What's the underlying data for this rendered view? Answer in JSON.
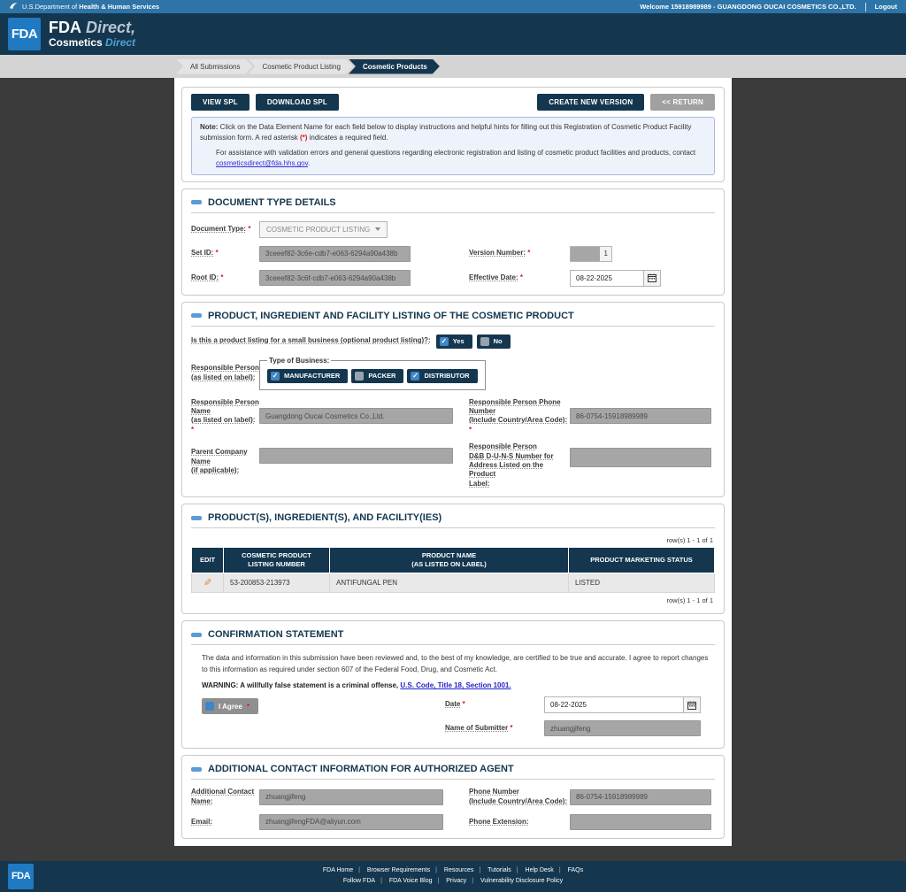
{
  "colors": {
    "navy": "#14374f",
    "topbar": "#2d74a8",
    "fdablue": "#1f7ac2",
    "linkblue": "#3333cc",
    "req": "#e01616",
    "fieldgray": "#a6a6a6",
    "editorange": "#d98e2b",
    "check": "#3f86c6"
  },
  "ui": {
    "req": "*"
  },
  "topbar": {
    "dept_prefix": "U.S.Department of ",
    "dept_bold": "Health & Human Services",
    "welcome": "Welcome 15918989989 - GUANGDONG OUCAI COSMETICS CO.,LTD.",
    "logout": "Logout"
  },
  "header": {
    "logo": "FDA",
    "title": "FDA",
    "title_italic": " Direct,",
    "subtitle": "Cosmetics",
    "subtitle_italic": " Direct"
  },
  "breadcrumb": {
    "items": [
      "All Submissions",
      "Cosmetic Product Listing",
      "Cosmetic Products"
    ]
  },
  "toolbar": {
    "view_spl": "VIEW SPL",
    "download_spl": "DOWNLOAD SPL",
    "create_new_version": "CREATE NEW VERSION",
    "return_label": "<< RETURN"
  },
  "note": {
    "label": "Note:",
    "body": " Click on the Data Element Name for each field below to display instructions and helpful hints for filling out this Registration of Cosmetic Product Facility submission form. A red asterisk ",
    "asterisk": "(*)",
    "tail": " indicates a required field.",
    "help_prefix": "For assistance with validation errors and general questions regarding electronic registration and listing of cosmetic product facilities and products, contact ",
    "help_link": "cosmeticsdirect@fda.hhs.gov",
    "help_suffix": "."
  },
  "document_type": {
    "title": "DOCUMENT TYPE DETAILS",
    "document_type_label": "Document Type:",
    "document_type_value": "COSMETIC PRODUCT LISTING",
    "set_id_label": "Set ID:",
    "set_id_value": "3ceeef82-3c6e-cdb7-e063-6294a90a438b",
    "version_label": "Version Number:",
    "version_value": "1",
    "root_id_label": "Root ID:",
    "root_id_value": "3ceeef82-3c6f-cdb7-e063-6294a90a438b",
    "effective_date_label": "Effective Date:",
    "effective_date_value": "08-22-2025"
  },
  "product_listing": {
    "title": "PRODUCT, INGREDIENT AND FACILITY LISTING OF THE COSMETIC PRODUCT",
    "small_business_question": "Is this a product listing for a small business (optional product listing)?:",
    "yes_label": "Yes",
    "no_label": "No",
    "yes_checked": true,
    "no_checked": false,
    "responsible_person_label": "Responsible Person\n(as listed on label):",
    "type_of_business_legend": "Type of Business:",
    "business_types": [
      {
        "label": "MANUFACTURER",
        "checked": true
      },
      {
        "label": "PACKER",
        "checked": false
      },
      {
        "label": "DISTRIBUTOR",
        "checked": true
      }
    ],
    "rp_name_label": "Responsible Person\nName\n(as listed on label):",
    "rp_name_value": "Guangdong Oucai Cosmetics Co.,Ltd.",
    "rp_phone_label": "Responsible Person Phone\nNumber\n(Include Country/Area Code):",
    "rp_phone_value": "86-0754-15918989989",
    "parent_company_label": "Parent Company Name\n(if applicable):",
    "parent_company_value": "",
    "duns_label": "Responsible Person\nD&B D-U-N-S Number for\nAddress Listed on the Product\nLabel:",
    "duns_value": ""
  },
  "products_table": {
    "title": "PRODUCT(S), INGREDIENT(S), AND FACILITY(IES)",
    "rowcount": "row(s) 1 - 1 of 1",
    "headers": {
      "edit": "EDIT",
      "listing_1": "COSMETIC PRODUCT",
      "listing_2": "LISTING NUMBER",
      "name_1": "PRODUCT NAME",
      "name_2": "(AS LISTED ON LABEL)",
      "status": "PRODUCT MARKETING STATUS"
    },
    "rows": [
      {
        "listing_number": "53-200853-213973",
        "product_name": "ANTIFUNGAL PEN",
        "status": "LISTED"
      }
    ]
  },
  "confirmation": {
    "title": "CONFIRMATION STATEMENT",
    "statement": "The data and information in this submission have been reviewed and, to the best of my knowledge, are certified to be true and accurate. I agree to report changes to this information as required under section 607 of the Federal Food, Drug, and Cosmetic Act.",
    "warning_prefix": "WARNING: A willfully false statement is a criminal offense, ",
    "warning_link": "U.S. Code, Title 18, Section 1001.",
    "agree_label": "I Agree",
    "agree_checked": true,
    "date_label": "Date",
    "date_value": "08-22-2025",
    "submitter_label": "Name of Submitter",
    "submitter_value": "zhuangjifeng"
  },
  "additional_contact": {
    "title": "ADDITIONAL CONTACT INFORMATION FOR AUTHORIZED AGENT",
    "name_label": "Additional Contact\nName:",
    "name_value": "zhuangjifeng",
    "phone_label": "Phone Number\n(Include Country/Area Code):",
    "phone_value": "86-0754-15918989989",
    "email_label": "Email:",
    "email_value": "zhuangjifengFDA@aliyun.com",
    "ext_label": "Phone Extension:",
    "ext_value": ""
  },
  "footer": {
    "logo": "FDA",
    "links_row1": [
      "FDA Home",
      "Browser Requirements",
      "Resources",
      "Tutorials",
      "Help Desk",
      "FAQs"
    ],
    "links_row2": [
      "Follow FDA",
      "FDA Voice Blog",
      "Privacy",
      "Vulnerability Disclosure Policy"
    ]
  }
}
